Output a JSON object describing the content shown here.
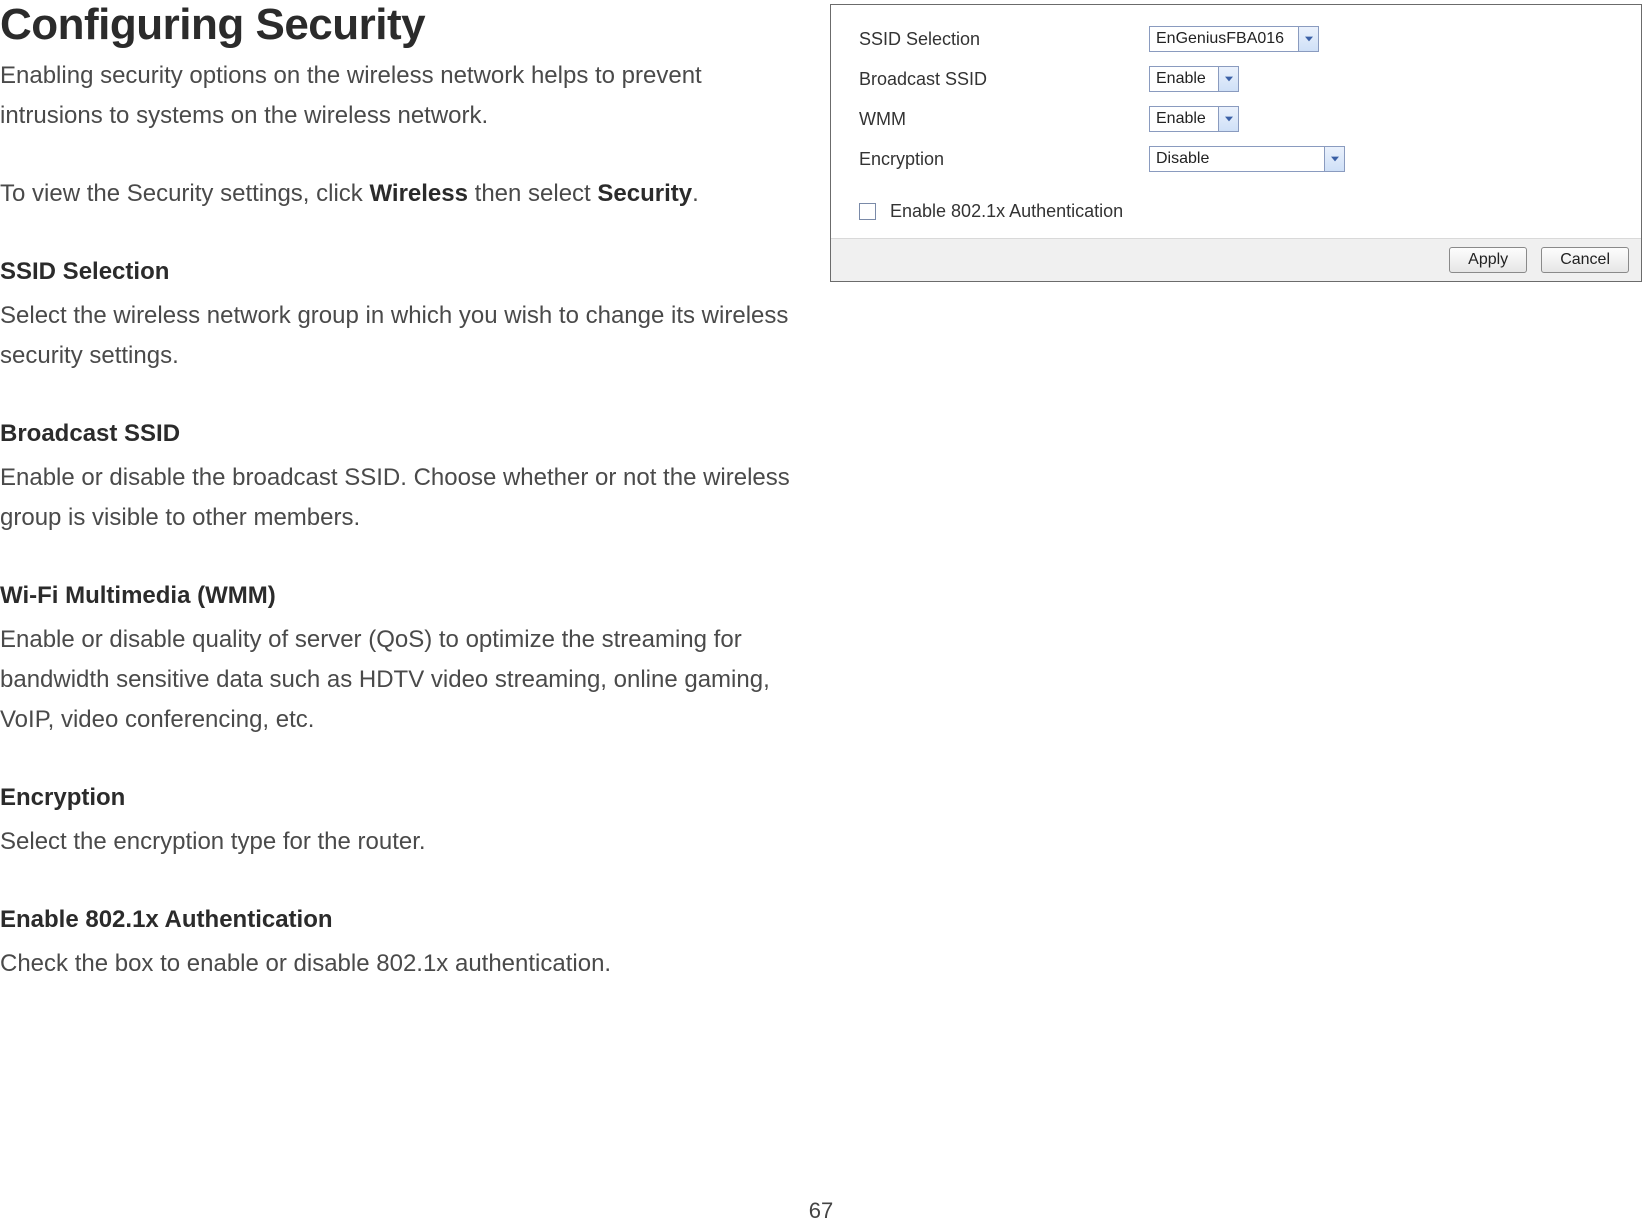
{
  "doc": {
    "title": "Configuring Security",
    "intro": "Enabling security options on the wireless network helps to prevent intrusions to systems on the wireless network.",
    "nav_prefix": "To view the Security settings, click ",
    "nav_bold1": "Wireless",
    "nav_mid": " then select ",
    "nav_bold2": "Security",
    "nav_suffix": ".",
    "sections": {
      "ssid": {
        "heading": "SSID Selection",
        "body": "Select the wireless network group in which you wish to change its wireless security settings."
      },
      "broadcast": {
        "heading": "Broadcast SSID",
        "body": "Enable or disable the broadcast SSID. Choose whether or not the wireless group is visible to other members."
      },
      "wmm": {
        "heading": "Wi-Fi Multimedia (WMM)",
        "body": "Enable or disable quality of server (QoS) to optimize the streaming for bandwidth sensitive data such as HDTV video streaming, online gaming, VoIP, video conferencing, etc."
      },
      "encryption": {
        "heading": "Encryption",
        "body": "Select the encryption type for the router."
      },
      "auth": {
        "heading": "Enable 802.1x Authentication",
        "body": "Check the box to enable or disable 802.1x authentication."
      }
    },
    "page_number": "67"
  },
  "panel": {
    "rows": {
      "ssid": {
        "label": "SSID Selection",
        "value": "EnGeniusFBA016"
      },
      "broadcast": {
        "label": "Broadcast SSID",
        "value": "Enable"
      },
      "wmm": {
        "label": "WMM",
        "value": "Enable"
      },
      "encryption": {
        "label": "Encryption",
        "value": "Disable"
      }
    },
    "checkbox": {
      "label": "Enable 802.1x Authentication",
      "checked": false
    },
    "buttons": {
      "apply": "Apply",
      "cancel": "Cancel"
    }
  }
}
